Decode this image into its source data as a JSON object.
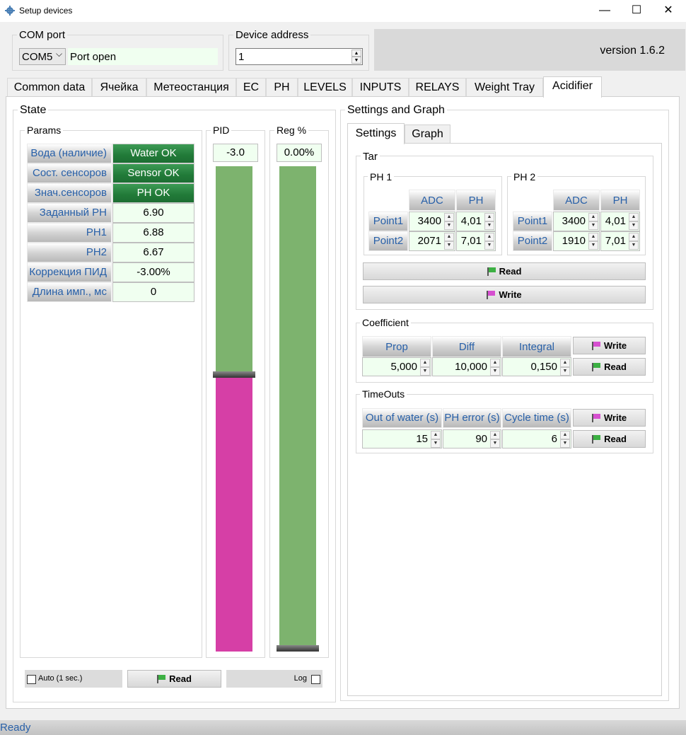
{
  "window": {
    "title": "Setup devices",
    "minimize": "—",
    "maximize": "☐",
    "close": "✕"
  },
  "com_port": {
    "group_label": "COM port",
    "selected": "COM5",
    "chevron": "⌵",
    "status": "Port open"
  },
  "device_address": {
    "group_label": "Device address",
    "value": "1"
  },
  "version": "version 1.6.2",
  "tabs": [
    "Common data",
    "Ячейка",
    "Метеостанция",
    "EC",
    "PH",
    "LEVELS",
    "INPUTS",
    "RELAYS",
    "Weight Tray",
    "Acidifier"
  ],
  "active_tab": "Acidifier",
  "state": {
    "label": "State",
    "params_label": "Params",
    "params": [
      {
        "label": "Вода (наличие)",
        "value": "Water OK"
      },
      {
        "label": "Сост. сенсоров",
        "value": "Sensor OK"
      },
      {
        "label": "Знач.сенсоров",
        "value": "PH OK"
      },
      {
        "label": "Заданный PH",
        "value": "6.90"
      },
      {
        "label": "PH1",
        "value": "6.88"
      },
      {
        "label": "PH2",
        "value": "6.67"
      },
      {
        "label": "Коррекция ПИД",
        "value": "-3.00%"
      },
      {
        "label": "Длина имп., мс",
        "value": "0"
      }
    ],
    "pid": {
      "label": "PID",
      "value": "-3.0",
      "level": 0.57
    },
    "reg": {
      "label": "Reg %",
      "value": "0.00%",
      "level": 0.0
    },
    "auto_label": "Auto (1 sec.)",
    "read_label": "Read",
    "log_label": "Log"
  },
  "settings": {
    "label": "Settings and Graph",
    "subtabs": [
      "Settings",
      "Graph"
    ],
    "tar": {
      "label": "Tar",
      "ph1": {
        "label": "PH 1",
        "cols": [
          "ADC",
          "PH"
        ],
        "rows": [
          {
            "name": "Point1",
            "adc": "3400",
            "ph": "4,01"
          },
          {
            "name": "Point2",
            "adc": "2071",
            "ph": "7,01"
          }
        ]
      },
      "ph2": {
        "label": "PH 2",
        "cols": [
          "ADC",
          "PH"
        ],
        "rows": [
          {
            "name": "Point1",
            "adc": "3400",
            "ph": "4,01"
          },
          {
            "name": "Point2",
            "adc": "1910",
            "ph": "7,01"
          }
        ]
      },
      "read_label": "Read",
      "write_label": "Write"
    },
    "coefficient": {
      "label": "Coefficient",
      "cols": [
        "Prop",
        "Diff",
        "Integral"
      ],
      "values": [
        "5,000",
        "10,000",
        "0,150"
      ],
      "write_label": "Write",
      "read_label": "Read"
    },
    "timeouts": {
      "label": "TimeOuts",
      "cols": [
        "Out of water (s)",
        "PH error (s)",
        "Cycle time (s)"
      ],
      "values": [
        "15",
        "90",
        "6"
      ],
      "write_label": "Write",
      "read_label": "Read"
    }
  },
  "status_text": "Ready",
  "colors": {
    "green_flag": "#3cb043",
    "pink_flag": "#d64fd0",
    "bar_green": "#7db36e",
    "bar_pink": "#d63fa6",
    "header_text": "#2860a8"
  }
}
